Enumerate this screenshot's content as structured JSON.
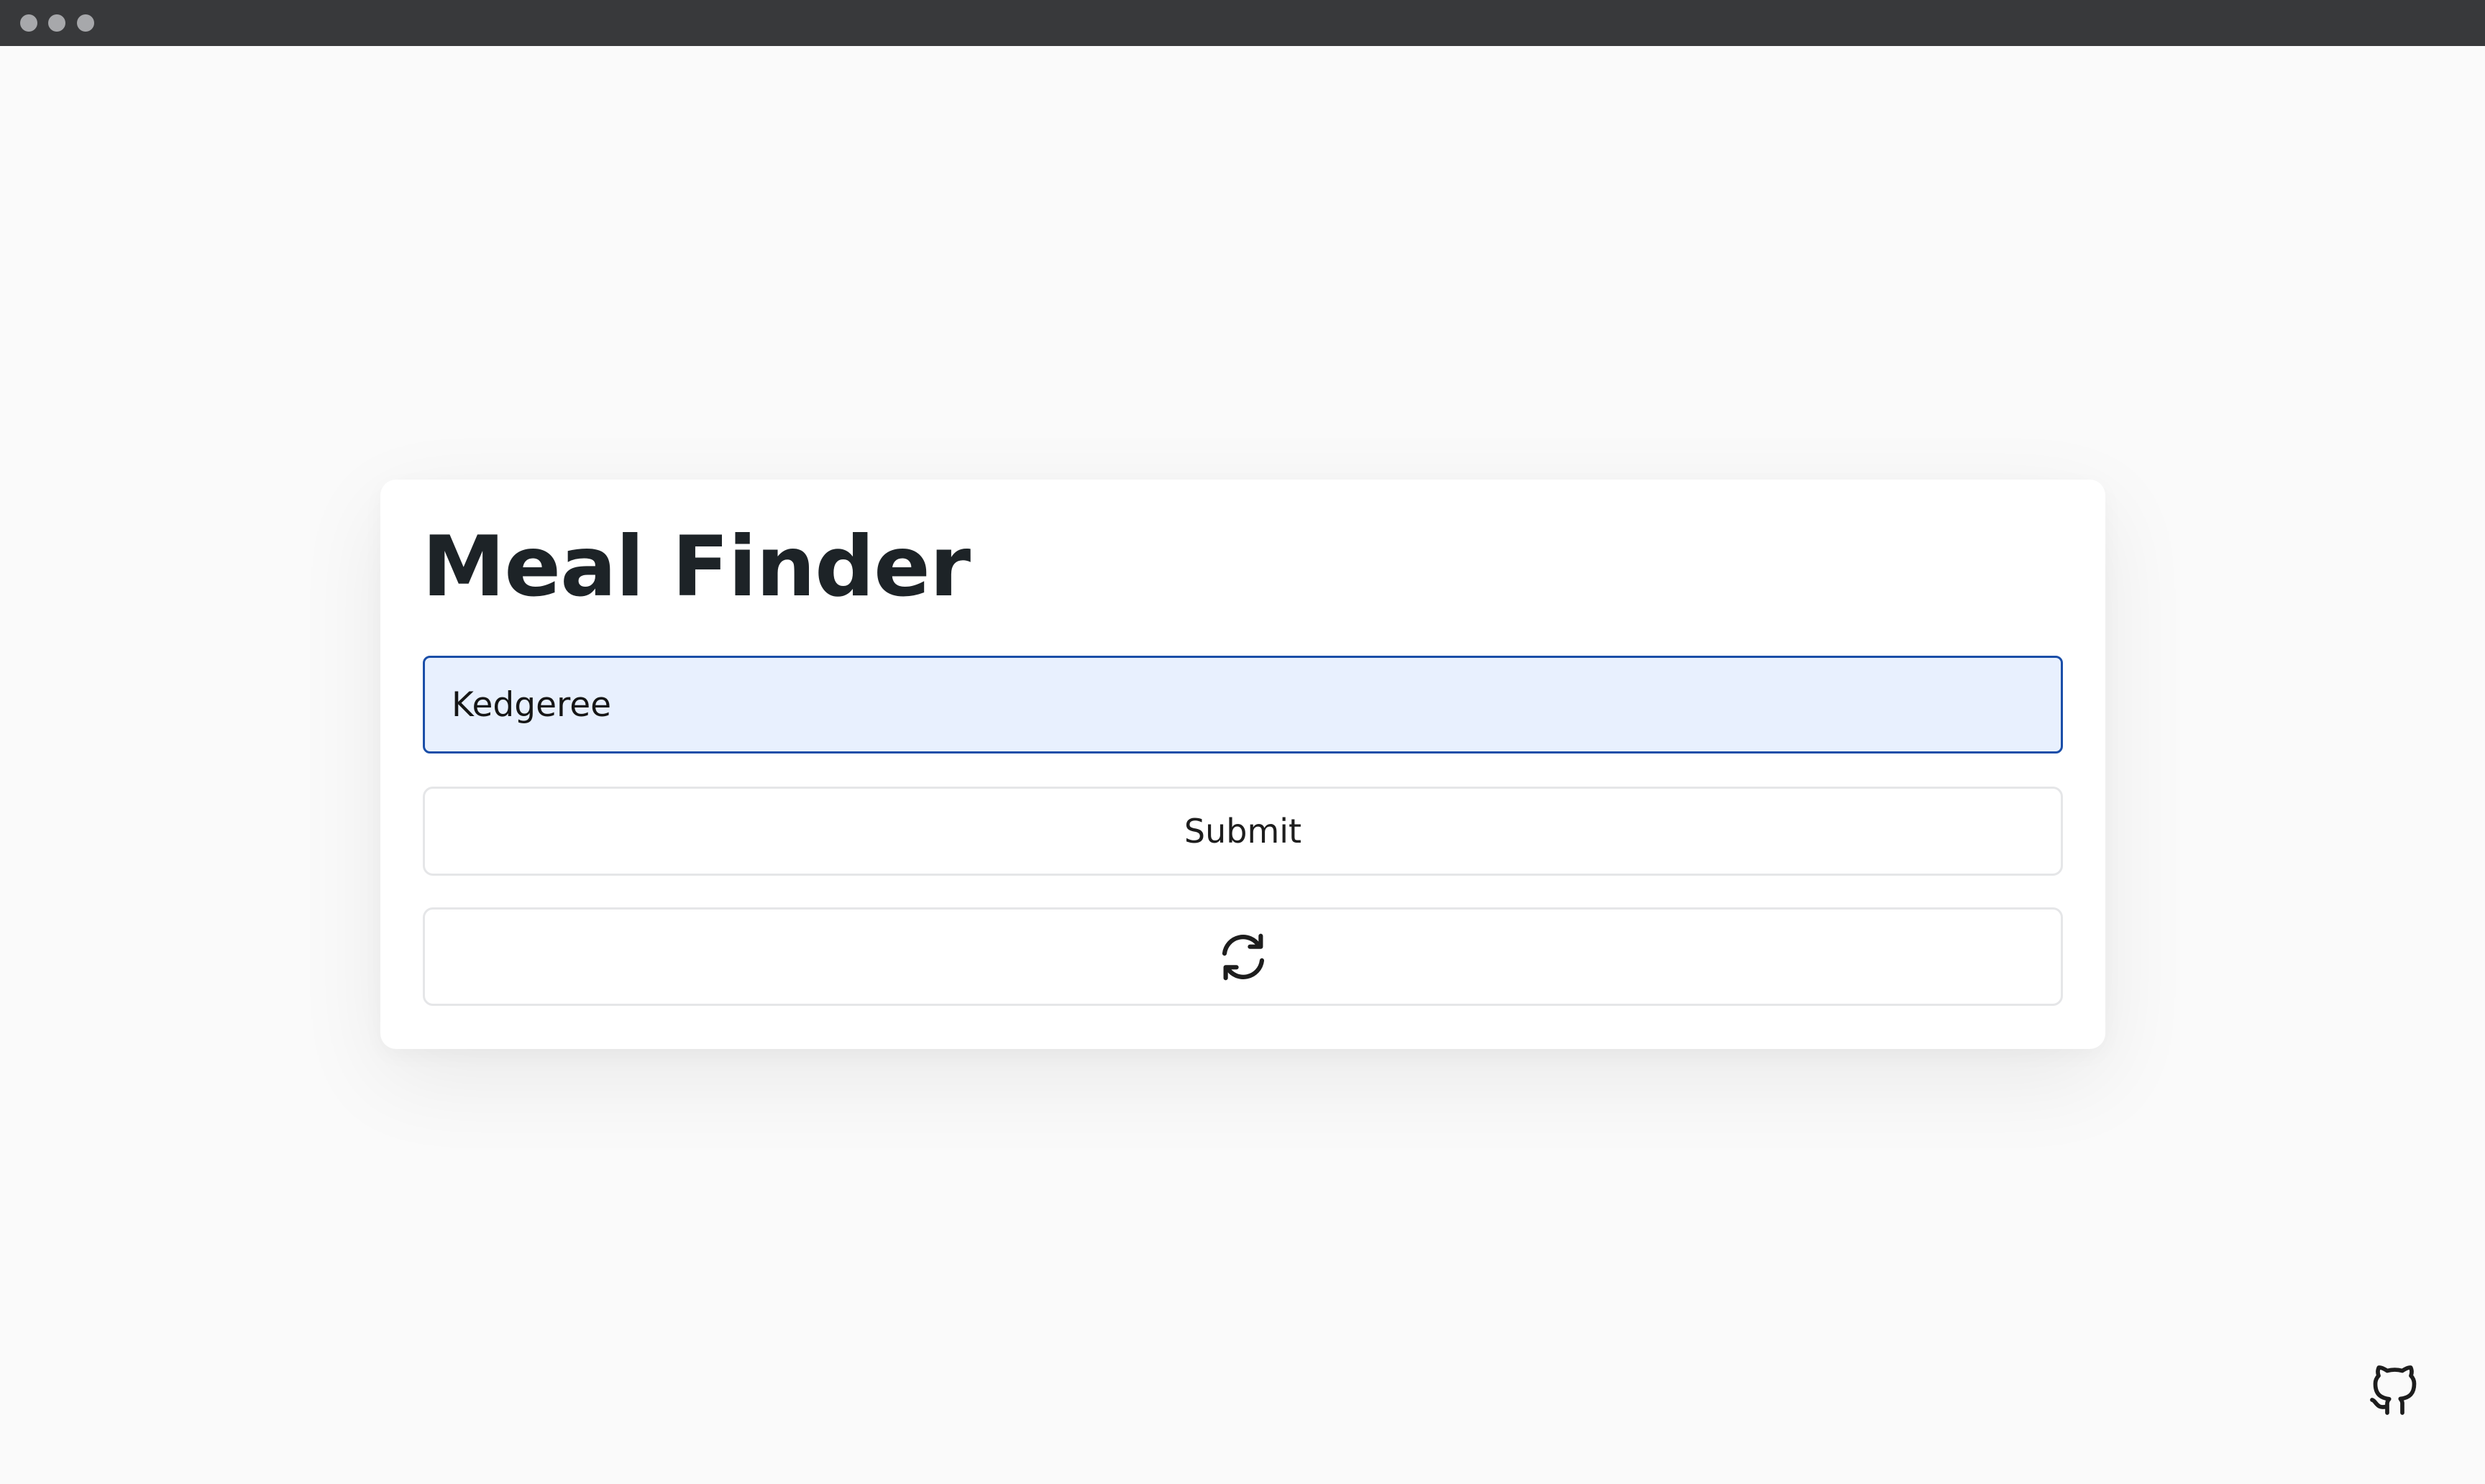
{
  "window": {
    "controls": [
      "close",
      "minimize",
      "maximize"
    ]
  },
  "app": {
    "title": "Meal Finder"
  },
  "search": {
    "value": "Kedgeree",
    "focused": true
  },
  "actions": {
    "submit_label": "Submit",
    "refresh_icon": "refresh-icon"
  },
  "footer": {
    "github_icon": "github-icon"
  },
  "colors": {
    "window_bar": "#38393b",
    "background": "#fafafa",
    "card": "#ffffff",
    "input_fill": "#e8f0fe",
    "input_border": "#1a4ea8",
    "button_border": "#e5e6e8",
    "title_text": "#1d2327"
  }
}
